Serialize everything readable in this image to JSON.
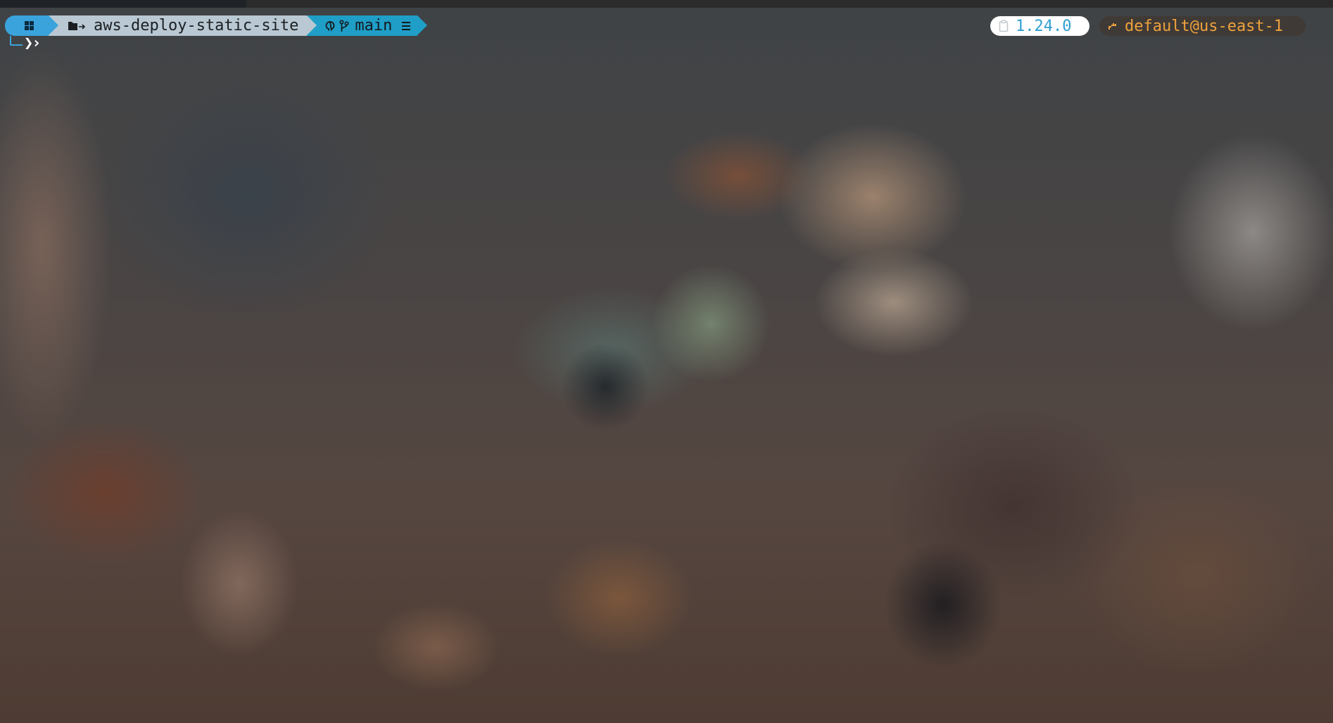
{
  "prompt": {
    "os_icon": "windows-icon",
    "folder_icon": "folder-arrow-icon",
    "path": "aws-deploy-static-site",
    "git": {
      "provider_icon": "github-icon",
      "branch_icon": "git-branch-icon",
      "branch": "main",
      "status_icon": "equal-status-icon"
    },
    "input_glyph": "❯›"
  },
  "right": {
    "version": {
      "icon": "clipboard-icon",
      "text": "1.24.0"
    },
    "aws": {
      "icon": "aws-key-icon",
      "text": "default@us-east-1"
    }
  },
  "colors": {
    "os_segment": "#3aa3dc",
    "path_segment": "#b9c8d3",
    "git_segment": "#1f9ec7",
    "version_text": "#2f9fd0",
    "aws_text": "#f0a23c"
  }
}
